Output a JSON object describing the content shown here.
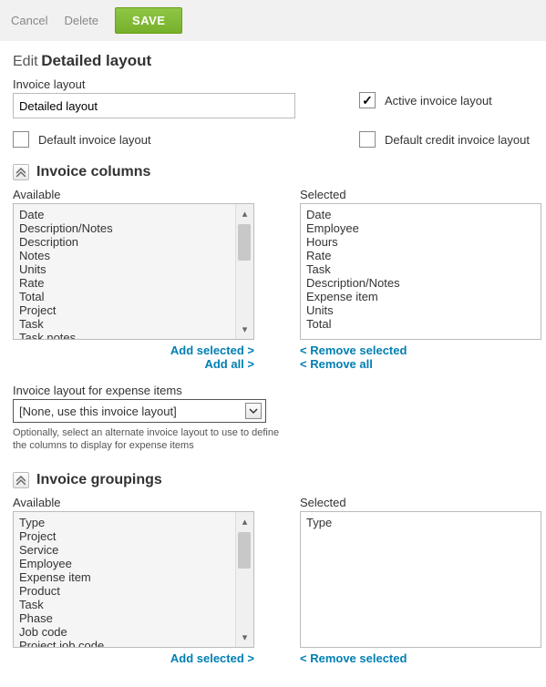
{
  "topbar": {
    "cancel": "Cancel",
    "delete": "Delete",
    "save": "SAVE"
  },
  "page": {
    "edit_prefix": "Edit",
    "title": "Detailed layout"
  },
  "fields": {
    "invoice_layout_label": "Invoice layout",
    "invoice_layout_value": "Detailed layout",
    "active_label": "Active invoice layout",
    "active_checked": true,
    "default_label": "Default invoice layout",
    "default_checked": false,
    "default_credit_label": "Default credit invoice layout",
    "default_credit_checked": false
  },
  "columns": {
    "section_title": "Invoice columns",
    "available_label": "Available",
    "selected_label": "Selected",
    "available": [
      "Date",
      "Description/Notes",
      "Description",
      "Notes",
      "Units",
      "Rate",
      "Total",
      "Project",
      "Task",
      "Task notes"
    ],
    "selected": [
      "Date",
      "Employee",
      "Hours",
      "Rate",
      "Task",
      "Description/Notes",
      "Expense item",
      "Units",
      "Total"
    ],
    "add_selected": "Add selected >",
    "add_all": "Add all >",
    "remove_selected": "< Remove selected",
    "remove_all": "< Remove all"
  },
  "expense_layout": {
    "label": "Invoice layout for expense items",
    "value": "[None, use this invoice layout]",
    "hint": "Optionally, select an alternate invoice layout to use to define the columns to display for expense items"
  },
  "groupings": {
    "section_title": "Invoice groupings",
    "available_label": "Available",
    "selected_label": "Selected",
    "available": [
      "Type",
      "Project",
      "Service",
      "Employee",
      "Expense item",
      "Product",
      "Task",
      "Phase",
      "Job code",
      "Project job code"
    ],
    "selected": [
      "Type"
    ],
    "add_selected": "Add selected >",
    "remove_selected": "< Remove selected"
  }
}
